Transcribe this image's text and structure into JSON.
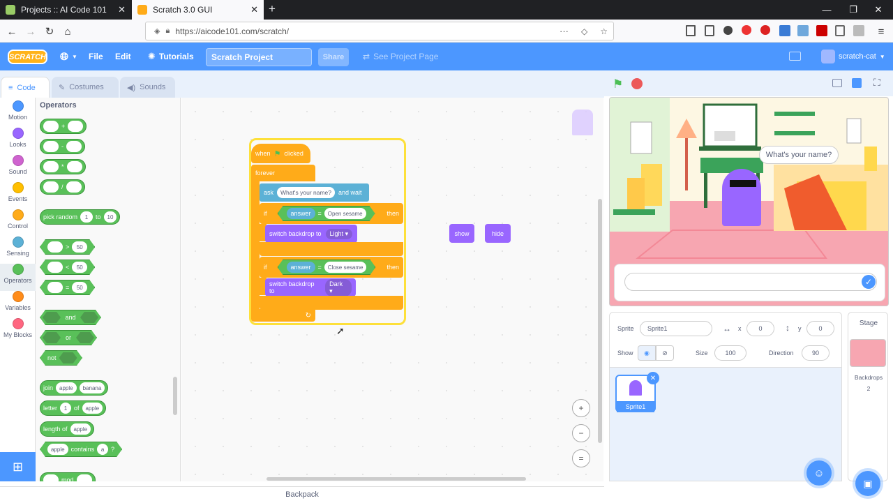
{
  "browser": {
    "tabs": [
      {
        "title": "Projects :: AI Code 101",
        "active": false
      },
      {
        "title": "Scratch 3.0 GUI",
        "active": true
      }
    ],
    "url": "https://aicode101.com/scratch/",
    "win_controls": [
      "—",
      "❐",
      "✕"
    ]
  },
  "menu": {
    "logo": "SCRATCH",
    "file": "File",
    "edit": "Edit",
    "tutorials": "Tutorials",
    "project_title": "Scratch Project",
    "share": "Share",
    "see_project_page": "See Project Page",
    "username": "scratch-cat"
  },
  "editor_tabs": {
    "code": "Code",
    "costumes": "Costumes",
    "sounds": "Sounds"
  },
  "categories": [
    {
      "label": "Motion",
      "color": "#4c97ff"
    },
    {
      "label": "Looks",
      "color": "#9966ff"
    },
    {
      "label": "Sound",
      "color": "#cf63cf"
    },
    {
      "label": "Events",
      "color": "#ffbf00"
    },
    {
      "label": "Control",
      "color": "#ffab19"
    },
    {
      "label": "Sensing",
      "color": "#5cb1d6"
    },
    {
      "label": "Operators",
      "color": "#59c059"
    },
    {
      "label": "Variables",
      "color": "#ff8c1a"
    },
    {
      "label": "My Blocks",
      "color": "#ff6680"
    }
  ],
  "palette": {
    "heading": "Operators",
    "arith": [
      "+",
      "-",
      "*",
      "/"
    ],
    "random": {
      "label": "pick random",
      "to": "to",
      "from_val": "1",
      "to_val": "10"
    },
    "compare": [
      {
        "op": ">",
        "val": "50"
      },
      {
        "op": "<",
        "val": "50"
      },
      {
        "op": "=",
        "val": "50"
      }
    ],
    "logic": {
      "and": "and",
      "or": "or",
      "not": "not"
    },
    "join": {
      "label": "join",
      "a": "apple",
      "b": "banana"
    },
    "letter": {
      "label": "letter",
      "n": "1",
      "of": "of",
      "word": "apple"
    },
    "length": {
      "label": "length of",
      "word": "apple"
    },
    "contains": {
      "word": "apple",
      "label": "contains",
      "ch": "a",
      "q": "?"
    },
    "mod": {
      "label": "mod"
    }
  },
  "script": {
    "when": "when",
    "clicked": "clicked",
    "forever": "forever",
    "ask": "ask",
    "ask_text": "What's your name?",
    "and_wait": "and wait",
    "if1": {
      "if": "if",
      "answer": "answer",
      "eq": "=",
      "value": "Open sesame",
      "then": "then",
      "switch": "switch backdrop to",
      "backdrop": "Light"
    },
    "if2": {
      "if": "if",
      "answer": "answer",
      "eq": "=",
      "value": "Close sesame",
      "then": "then",
      "switch": "switch backdrop to",
      "backdrop": "Dark"
    },
    "show": "show",
    "hide": "hide"
  },
  "zoom": {
    "in": "+",
    "out": "−",
    "reset": "="
  },
  "backpack": "Backpack",
  "stage": {
    "speech": "What's your name?"
  },
  "sprite_info": {
    "sprite_label": "Sprite",
    "sprite_name": "Sprite1",
    "x_label": "x",
    "x": "0",
    "y_label": "y",
    "y": "0",
    "show_label": "Show",
    "size_label": "Size",
    "size": "100",
    "direction_label": "Direction",
    "direction": "90"
  },
  "sprites": [
    {
      "name": "Sprite1"
    }
  ],
  "stage_pane": {
    "title": "Stage",
    "backdrops_label": "Backdrops",
    "backdrops_count": "2"
  }
}
